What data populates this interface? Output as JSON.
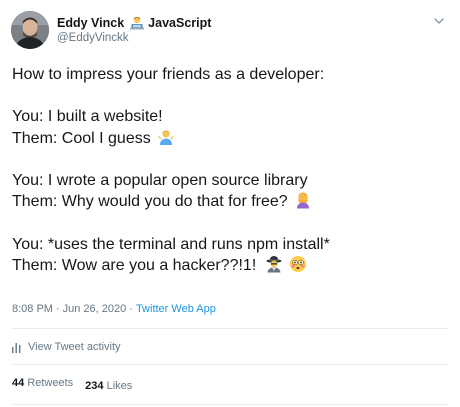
{
  "author": {
    "display_name": "Eddy Vinck",
    "name_emoji": "man-technologist-emoji",
    "name_suffix": "JavaScript",
    "handle": "@EddyVinckk"
  },
  "icons": {
    "avatar": "profile-photo",
    "more": "chevron-down-icon",
    "activity": "bar-chart-icon"
  },
  "tweet": {
    "lines": [
      {
        "text": "How to impress your friends as a developer:",
        "emoji": null
      },
      {
        "text": "",
        "emoji": null
      },
      {
        "text": "You: I built a website!",
        "emoji": null
      },
      {
        "text": "Them: Cool I guess",
        "emoji": "man-shrugging-emoji"
      },
      {
        "text": "",
        "emoji": null
      },
      {
        "text": "You: I wrote a popular open source library",
        "emoji": null
      },
      {
        "text": "Them: Why would you do that for free?",
        "emoji": "woman-facepalming-emoji"
      },
      {
        "text": "",
        "emoji": null
      },
      {
        "text": "You: *uses the terminal and runs npm install*",
        "emoji": null
      },
      {
        "text": "Them: Wow are you a hacker??!1!",
        "emoji": "detective-and-flushed-face-emoji"
      }
    ],
    "time": "8:08 PM",
    "separator": "·",
    "date": "Jun 26, 2020",
    "source": "Twitter Web App"
  },
  "activity": {
    "label": "View Tweet activity"
  },
  "stats": {
    "retweets_count": "44",
    "retweets_label": "Retweets",
    "likes_count": "234",
    "likes_label": "Likes"
  },
  "colors": {
    "text": "#14171a",
    "secondary": "#657786",
    "link": "#1b95e0",
    "divider": "#e6ecf0"
  }
}
